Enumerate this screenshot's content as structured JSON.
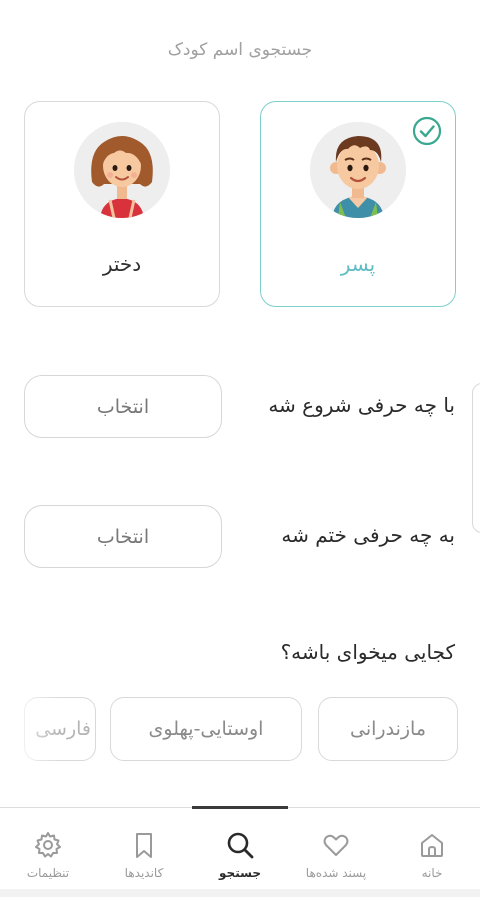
{
  "header": {
    "title": "جستجوی اسم کودک"
  },
  "gender": {
    "boy": {
      "label": "پسر",
      "selected": true,
      "icon": "boy-avatar-icon"
    },
    "girl": {
      "label": "دختر",
      "selected": false,
      "icon": "girl-avatar-icon"
    }
  },
  "starts_with": {
    "label": "با چه حرفی شروع شه",
    "value": "انتخاب"
  },
  "ends_with": {
    "label": "به چه حرفی ختم شه",
    "value": "انتخاب"
  },
  "origin": {
    "label": "کجایی میخوای باشه؟",
    "options": [
      "مازندرانی",
      "اوستایی-پهلوی",
      "فارسی"
    ]
  },
  "nav": {
    "items": [
      {
        "label": "خانه",
        "icon": "home-icon"
      },
      {
        "label": "پسند شده‌ها",
        "icon": "heart-icon"
      },
      {
        "label": "جستجو",
        "icon": "search-icon",
        "active": true
      },
      {
        "label": "کاندیدها",
        "icon": "bookmark-icon"
      },
      {
        "label": "تنظیمات",
        "icon": "gear-icon"
      }
    ]
  },
  "colors": {
    "accent": "#5fbcc4",
    "selected_border": "#7ccfcc",
    "check": "#3aa890"
  }
}
